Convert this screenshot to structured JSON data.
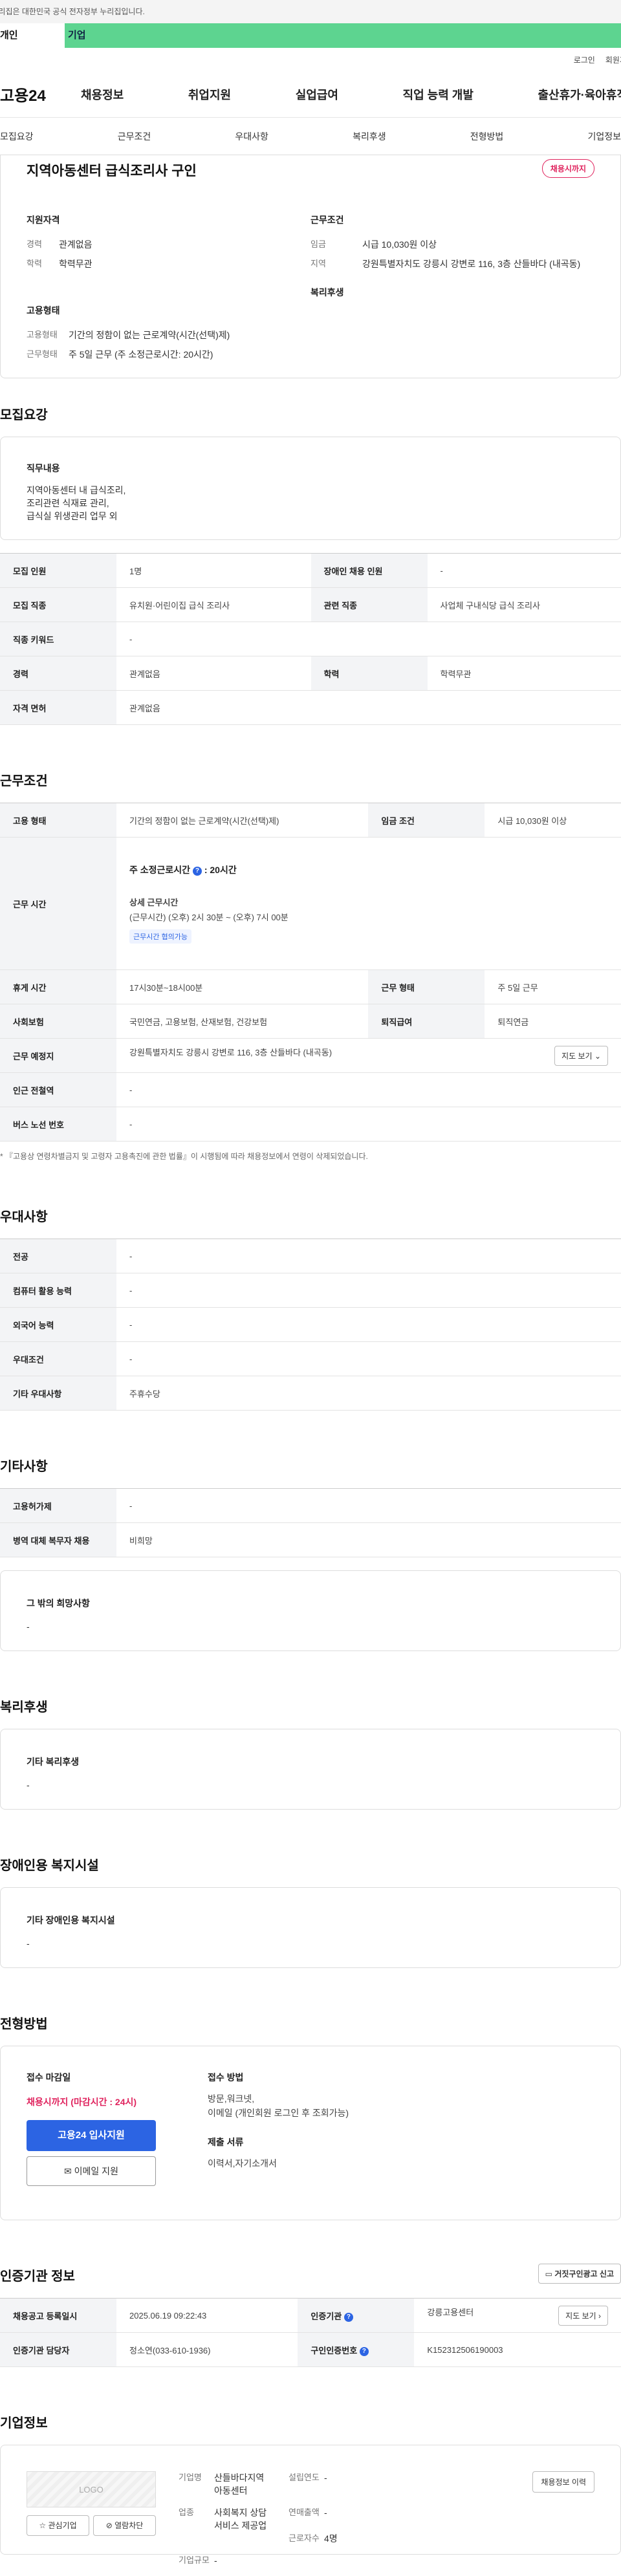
{
  "gov_banner": "이 누리집은 대한민국 공식 전자정부 누리집입니다.",
  "tabs": [
    "개인",
    "기업"
  ],
  "util": [
    "로그인",
    "회원가입"
  ],
  "logo": "고용24",
  "gnb": [
    "채용정보",
    "취업지원",
    "실업급여",
    "직업 능력 개발",
    "출산휴가·육아휴직"
  ],
  "subnav": [
    "모집요강",
    "근무조건",
    "우대사항",
    "복리후생",
    "전형방법",
    "기업정보"
  ],
  "summary": {
    "title": "지역아동센터 급식조리사 구인",
    "deadline_badge": "채용시까지",
    "qual_h": "지원자격",
    "qual": [
      [
        "경력",
        "관계없음"
      ],
      [
        "학력",
        "학력무관"
      ]
    ],
    "cond_h": "근무조건",
    "cond": [
      [
        "임금",
        "시급 10,030원 이상"
      ],
      [
        "지역",
        "강원특별자치도 강릉시 강변로 116, 3층 산들바다 (내곡동)"
      ]
    ],
    "emp_h": "고용형태",
    "emp": [
      [
        "고용형태",
        "기간의 정함이 없는 근로계약(시간(선택)제)"
      ],
      [
        "근무형태",
        "주 5일 근무 (주 소정근로시간: 20시간)"
      ]
    ],
    "welfare_h": "복리후생"
  },
  "recruit": {
    "title": "모집요강",
    "duty_h": "직무내용",
    "duty": "지역아동센터 내 급식조리,\n조리관련 식재료 관리,\n급식실 위생관리 업무 외",
    "rows": [
      [
        "모집 인원",
        "1명",
        "장애인 채용 인원",
        "-"
      ],
      [
        "모집 직종",
        "유치원·어린이집 급식 조리사",
        "관련 직종",
        "사업체 구내식당 급식 조리사"
      ],
      [
        "직종 키워드",
        "-"
      ],
      [
        "경력",
        "관계없음",
        "학력",
        "학력무관"
      ],
      [
        "자격 면허",
        "관계없음"
      ]
    ]
  },
  "work": {
    "title": "근무조건",
    "emp_k": "고용 형태",
    "emp_v": "기간의 정함이 없는 근로계약(시간(선택)제)",
    "wage_k": "임금 조건",
    "wage_v": "시급 10,030원 이상",
    "hours_k": "근무 시간",
    "hours_title": "주 소정근로시간",
    "hours_value": ": 20시간",
    "hours_detail_h": "상세 근무시간",
    "hours_detail": "(근무시간) (오후) 2시 30분 ~ (오후) 7시 00분",
    "hours_chip": "근무시간 협의가능",
    "rest_k": "휴게 시간",
    "rest_v": "17시30분~18시00분",
    "type_k": "근무 형태",
    "type_v": "주 5일 근무",
    "ins_k": "사회보험",
    "ins_v": "국민연금, 고용보험, 산재보험, 건강보험",
    "ret_k": "퇴직급여",
    "ret_v": "퇴직연금",
    "place_k": "근무 예정지",
    "place_v": "강원특별자치도 강릉시 강변로 116, 3층 산들바다 (내곡동)",
    "map_btn": "지도 보기",
    "sub_k": "인근 전철역",
    "sub_v": "-",
    "bus_k": "버스 노선 번호",
    "bus_v": "-",
    "note": "* 『고용상 연령차별금지 및 고령자 고용촉진에 관한 법률』이 시행됨에 따라 채용정보에서 연령이 삭제되었습니다."
  },
  "pref": {
    "title": "우대사항",
    "rows": [
      [
        "전공",
        "-"
      ],
      [
        "컴퓨터 활용 능력",
        "-"
      ],
      [
        "외국어 능력",
        "-"
      ],
      [
        "우대조건",
        "-"
      ],
      [
        "기타 우대사항",
        "주휴수당"
      ]
    ]
  },
  "etc": {
    "title": "기타사항",
    "rows": [
      [
        "고용허가제",
        "-"
      ],
      [
        "병역 대체 복무자 채용",
        "비희망"
      ]
    ],
    "box_h": "그 밖의 희망사항",
    "box_v": "-"
  },
  "welfare": {
    "title": "복리후생",
    "box_h": "기타 복리후생",
    "box_v": "-"
  },
  "disabled": {
    "title": "장애인용 복지시설",
    "box_h": "기타 장애인용 복지시설",
    "box_v": "-"
  },
  "selection": {
    "title": "전형방법",
    "deadline_h": "접수 마감일",
    "deadline_v": "채용시까지 (마감시간 : 24시)",
    "apply_btn": "고용24 입사지원",
    "email_btn": "이메일 지원",
    "method_h": "접수 방법",
    "method_v": "방문,워크넷,\n이메일 (개인회원 로그인 후 조회가능)",
    "docs_h": "제출 서류",
    "docs_v": "이력서,자기소개서"
  },
  "cert": {
    "title": "인증기관 정보",
    "report_btn": "거짓구인광고 신고",
    "r1": [
      "채용공고 등록일시",
      "2025.06.19 09:22:43",
      "인증기관",
      "강릉고용센터"
    ],
    "r2": [
      "인증기관 담당자",
      "정소연(033-610-1936)",
      "구인인증번호",
      "K152312506190003"
    ],
    "map_btn": "지도 보기"
  },
  "company": {
    "title": "기업정보",
    "logo_ph": "LOGO",
    "fav_btn": "관심기업",
    "block_btn": "열람차단",
    "hist_btn": "채용정보 이력",
    "rows": [
      [
        "기업명",
        "산들바다지역아동센터",
        "설립연도",
        "-"
      ],
      [
        "업종",
        "사회복지 상담서비스 제공업",
        "연매출액",
        "-"
      ],
      [
        "",
        "",
        "근로자수",
        "4명"
      ],
      [
        "기업규모",
        "-",
        "",
        ""
      ]
    ]
  },
  "colors": {
    "accent": "#2c64e3",
    "green": "#5dd490",
    "danger": "#e0245e"
  }
}
